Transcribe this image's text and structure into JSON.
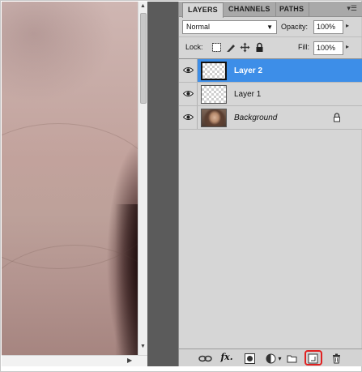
{
  "panel": {
    "tabs": [
      {
        "label": "LAYERS",
        "active": true
      },
      {
        "label": "CHANNELS",
        "active": false
      },
      {
        "label": "PATHS",
        "active": false
      }
    ],
    "menu_icon": "panel-menu-icon",
    "blend_mode": "Normal",
    "opacity_label": "Opacity:",
    "opacity_value": "100%",
    "lock_label": "Lock:",
    "fill_label": "Fill:",
    "fill_value": "100%"
  },
  "layers": [
    {
      "name": "Layer 2",
      "selected": true,
      "visible": true,
      "thumbnail": "transparent"
    },
    {
      "name": "Layer 1",
      "selected": false,
      "visible": true,
      "thumbnail": "transparent"
    },
    {
      "name": "Background",
      "selected": false,
      "visible": true,
      "thumbnail": "photo",
      "locked": true,
      "italic": true
    }
  ],
  "bottom_bar": {
    "fx_label": "fx.",
    "highlighted_button": "new-layer-button"
  },
  "colors": {
    "selection": "#3d8ee8",
    "panel_bg": "#d6d6d6",
    "highlight_ring": "#e02020"
  }
}
